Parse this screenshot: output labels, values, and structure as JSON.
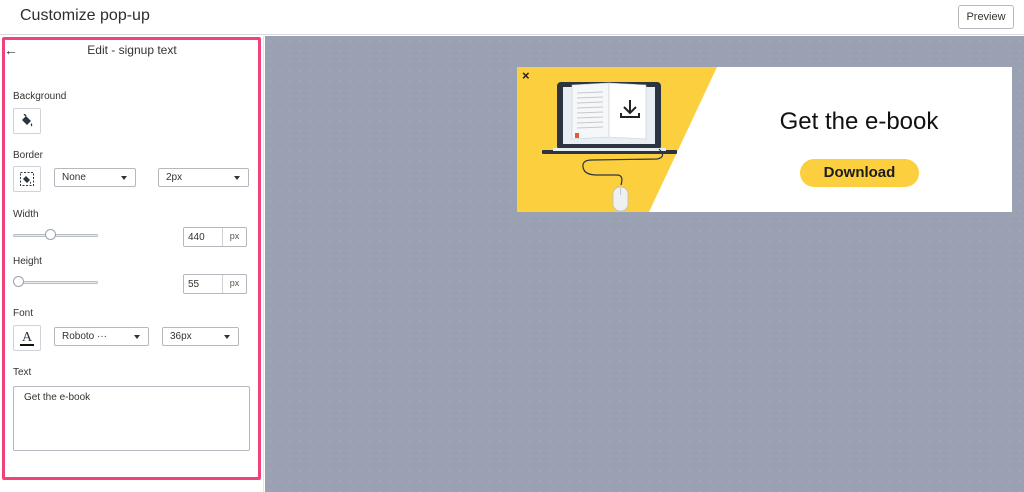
{
  "header": {
    "title": "Customize pop-up",
    "preview_label": "Preview"
  },
  "panel": {
    "title": "Edit - signup text",
    "background": {
      "label": "Background"
    },
    "border": {
      "label": "Border",
      "style_value": "None",
      "width_value": "2px"
    },
    "width": {
      "label": "Width",
      "value": "440",
      "unit": "px",
      "slider_fraction": 0.43
    },
    "height": {
      "label": "Height",
      "value": "55",
      "unit": "px",
      "slider_fraction": 0.0
    },
    "font": {
      "label": "Font",
      "family_value": "Roboto ···",
      "size_value": "36px"
    },
    "text": {
      "label": "Text",
      "value": "Get the e-book"
    }
  },
  "popup": {
    "heading": "Get the e-book",
    "button_label": "Download",
    "close_glyph": "×"
  },
  "colors": {
    "highlight": "#f0437a",
    "canvas": "#9aa1b3",
    "accent_yellow": "#fccf3f",
    "dark_navy": "#2b3440"
  },
  "icons": [
    "back-arrow-icon",
    "paint-bucket-icon",
    "border-fill-icon",
    "font-color-icon",
    "close-icon",
    "laptop-book-illustration",
    "download-icon",
    "mouse-icon"
  ]
}
